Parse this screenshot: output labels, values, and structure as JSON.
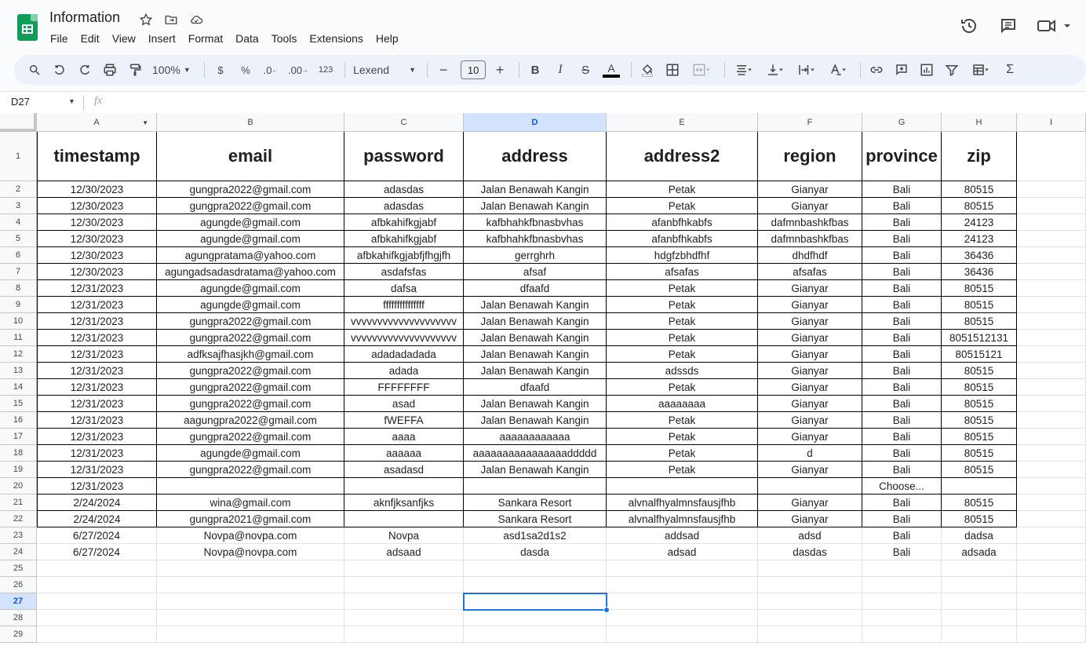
{
  "app": {
    "doc_title": "Information",
    "menu": [
      "File",
      "Edit",
      "View",
      "Insert",
      "Format",
      "Data",
      "Tools",
      "Extensions",
      "Help"
    ]
  },
  "toolbar": {
    "zoom": "100%",
    "currency": "$",
    "percent": "%",
    "decrease_decimal": ".0",
    "increase_decimal": ".00",
    "format_123": "123",
    "font": "Lexend",
    "font_size": "10",
    "bold": "B",
    "italic": "I",
    "strike": "S",
    "text_color_letter": "A",
    "text_color": "#000000"
  },
  "formula_bar": {
    "name_box": "D27",
    "fx": "fx"
  },
  "sheet": {
    "columns": [
      "A",
      "B",
      "C",
      "D",
      "E",
      "F",
      "G",
      "H",
      "I"
    ],
    "selected_column": "D",
    "selected_row": 27,
    "header_row": [
      "timestamp",
      "email",
      "password",
      "address",
      "address2",
      "region",
      "province",
      "zip"
    ],
    "rows": [
      [
        "12/30/2023",
        "gungpra2022@gmail.com",
        "adasdas",
        "Jalan Benawah Kangin",
        "Petak",
        "Gianyar",
        "Bali",
        "80515"
      ],
      [
        "12/30/2023",
        "gungpra2022@gmail.com",
        "adasdas",
        "Jalan Benawah Kangin",
        "Petak",
        "Gianyar",
        "Bali",
        "80515"
      ],
      [
        "12/30/2023",
        "agungde@gmail.com",
        "afbkahifkgjabf",
        "kafbhahkfbnasbvhas",
        "afanbfhkabfs",
        "dafmnbashkfbas",
        "Bali",
        "24123"
      ],
      [
        "12/30/2023",
        "agungde@gmail.com",
        "afbkahifkgjabf",
        "kafbhahkfbnasbvhas",
        "afanbfhkabfs",
        "dafmnbashkfbas",
        "Bali",
        "24123"
      ],
      [
        "12/30/2023",
        "agungpratama@yahoo.com",
        "afbkahifkgjabfjfhgjfh",
        "gerrghrh",
        "hdgfzbhdfhf",
        "dhdfhdf",
        "Bali",
        "36436"
      ],
      [
        "12/30/2023",
        "agungadsadasdratama@yahoo.com",
        "asdafsfas",
        "afsaf",
        "afsafas",
        "afsafas",
        "Bali",
        "36436"
      ],
      [
        "12/31/2023",
        "agungde@gmail.com",
        "dafsa",
        "dfaafd",
        "Petak",
        "Gianyar",
        "Bali",
        "80515"
      ],
      [
        "12/31/2023",
        "agungde@gmail.com",
        "fffffffffffffff",
        "Jalan Benawah Kangin",
        "Petak",
        "Gianyar",
        "Bali",
        "80515"
      ],
      [
        "12/31/2023",
        "gungpra2022@gmail.com",
        "vvvvvvvvvvvvvvvvvvvv",
        "Jalan Benawah Kangin",
        "Petak",
        "Gianyar",
        "Bali",
        "80515"
      ],
      [
        "12/31/2023",
        "gungpra2022@gmail.com",
        "vvvvvvvvvvvvvvvvvvvv",
        "Jalan Benawah Kangin",
        "Petak",
        "Gianyar",
        "Bali",
        "8051512131"
      ],
      [
        "12/31/2023",
        "adfksajfhasjkh@gmail.com",
        "adadadadada",
        "Jalan Benawah Kangin",
        "Petak",
        "Gianyar",
        "Bali",
        "80515121"
      ],
      [
        "12/31/2023",
        "gungpra2022@gmail.com",
        "adada",
        "Jalan Benawah Kangin",
        "adssds",
        "Gianyar",
        "Bali",
        "80515"
      ],
      [
        "12/31/2023",
        "gungpra2022@gmail.com",
        "FFFFFFFF",
        "dfaafd",
        "Petak",
        "Gianyar",
        "Bali",
        "80515"
      ],
      [
        "12/31/2023",
        "gungpra2022@gmail.com",
        "asad",
        "Jalan Benawah Kangin",
        "aaaaaaaa",
        "Gianyar",
        "Bali",
        "80515"
      ],
      [
        "12/31/2023",
        "aagungpra2022@gmail.com",
        "fWEFFA",
        "Jalan Benawah Kangin",
        "Petak",
        "Gianyar",
        "Bali",
        "80515"
      ],
      [
        "12/31/2023",
        "gungpra2022@gmail.com",
        "aaaa",
        "aaaaaaaaaaaa",
        "Petak",
        "Gianyar",
        "Bali",
        "80515"
      ],
      [
        "12/31/2023",
        "agungde@gmail.com",
        "aaaaaa",
        "aaaaaaaaaaaaaaaaddddd",
        "Petak",
        "d",
        "Bali",
        "80515"
      ],
      [
        "12/31/2023",
        "gungpra2022@gmail.com",
        "asadasd",
        "Jalan Benawah Kangin",
        "Petak",
        "Gianyar",
        "Bali",
        "80515"
      ],
      [
        "12/31/2023",
        "",
        "",
        "",
        "",
        "",
        "Choose...",
        ""
      ],
      [
        "2/24/2024",
        "wina@gmail.com",
        "aknfjksanfjks",
        "Sankara Resort",
        "alvnalfhyalmnsfausjfhb",
        "Gianyar",
        "Bali",
        "80515"
      ],
      [
        "2/24/2024",
        "gungpra2021@gmail.com",
        "",
        "Sankara Resort",
        "alvnalfhyalmnsfausjfhb",
        "Gianyar",
        "Bali",
        "80515"
      ],
      [
        "6/27/2024",
        "Novpa@novpa.com",
        "Novpa",
        "asd1sa2d1s2",
        "addsad",
        "adsd",
        "Bali",
        "dadsa"
      ],
      [
        "6/27/2024",
        "Novpa@novpa.com",
        "adsaad",
        "dasda",
        "adsad",
        "dasdas",
        "Bali",
        "adsada"
      ]
    ],
    "empty_rows": [
      25,
      26,
      27,
      28,
      29
    ]
  }
}
